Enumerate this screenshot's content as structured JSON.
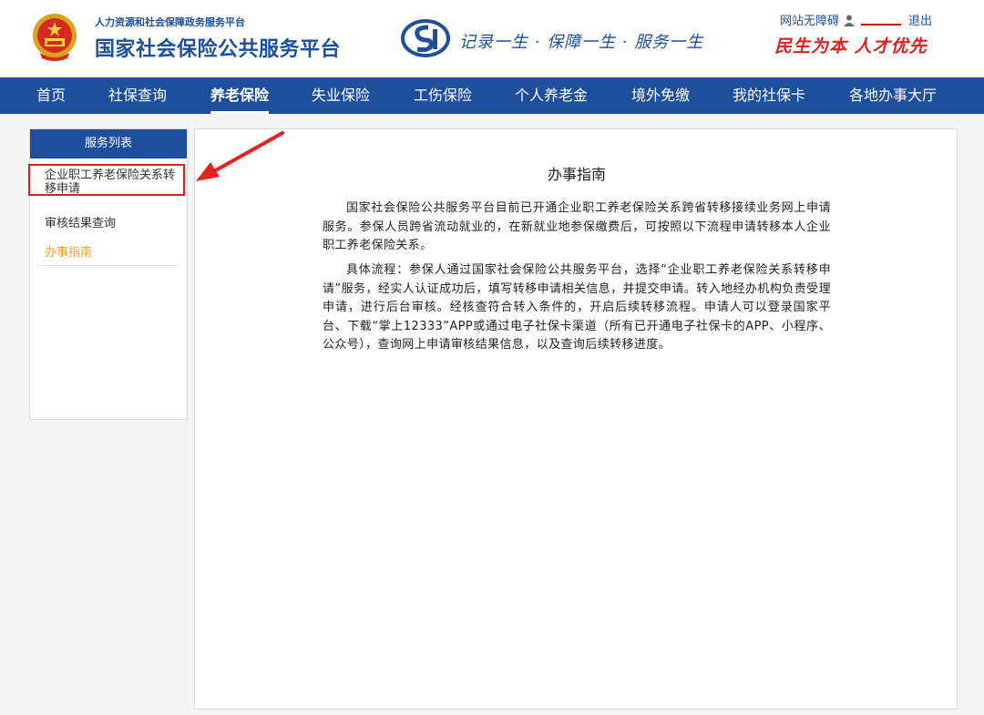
{
  "header": {
    "org_subtitle": "人力资源和社会保障政务服务平台",
    "org_title": "国家社会保险公共服务平台",
    "slogan": "记录一生 · 保障一生 · 服务一生",
    "motto": "民生为本 人才优先",
    "accessibility_link": "网站无障碍",
    "user_name": "",
    "logout_label": "退出"
  },
  "nav": {
    "items": [
      {
        "label": "首页"
      },
      {
        "label": "社保查询"
      },
      {
        "label": "养老保险"
      },
      {
        "label": "失业保险"
      },
      {
        "label": "工伤保险"
      },
      {
        "label": "个人养老金"
      },
      {
        "label": "境外免缴"
      },
      {
        "label": "我的社保卡"
      },
      {
        "label": "各地办事大厅"
      }
    ],
    "active": "养老保险"
  },
  "sidebar": {
    "title": "服务列表",
    "items": [
      {
        "label": "企业职工养老保险关系转移申请"
      },
      {
        "label": "审核结果查询"
      },
      {
        "label": "办事指南"
      }
    ],
    "active": "办事指南"
  },
  "content": {
    "title": "办事指南",
    "paragraph1": "国家社会保险公共服务平台目前已开通企业职工养老保险关系跨省转移接续业务网上申请服务。参保人员跨省流动就业的，在新就业地参保缴费后，可按照以下流程申请转移本人企业职工养老保险关系。",
    "paragraph2": "具体流程：参保人通过国家社会保险公共服务平台，选择“企业职工养老保险关系转移申请”服务，经实人认证成功后，填写转移申请相关信息，并提交申请。转入地经办机构负责受理申请，进行后台审核。经核查符合转入条件的，开启后续转移流程。申请人可以登录国家平台、下载“掌上12333”APP或通过电子社保卡渠道（所有已开通电子社保卡的APP、小程序、公众号），查询网上申请审核结果信息，以及查询后续转移进度。"
  },
  "colors": {
    "brand_blue": "#1e4f9c",
    "highlight_red": "#e02020",
    "active_orange": "#f29c2c"
  }
}
